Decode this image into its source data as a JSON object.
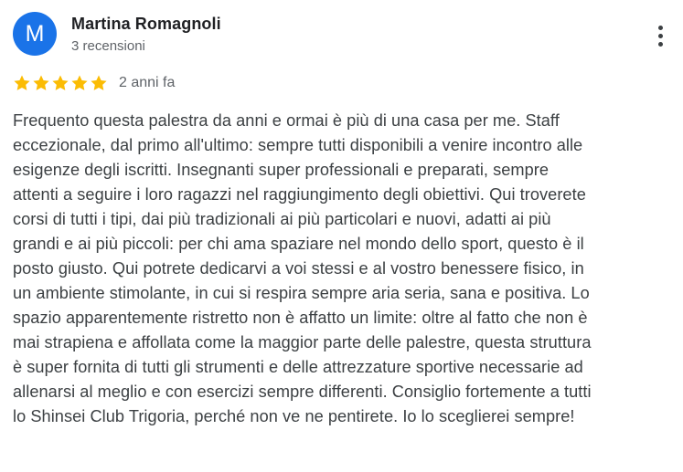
{
  "reviewer": {
    "avatar_initial": "M",
    "name": "Martina Romagnoli",
    "meta": "3 recensioni",
    "avatar_color": "#1a73e8"
  },
  "review": {
    "rating": 5,
    "max_rating": 5,
    "star_color": "#fbbc04",
    "date": "2 anni fa",
    "text_lines": [
      "Frequento questa palestra da anni e ormai è più di una casa per me. Staff",
      "eccezionale, dal primo all'ultimo: sempre tutti disponibili a venire incontro alle",
      "esigenze degli iscritti. Insegnanti super professionali e preparati, sempre",
      "attenti a seguire i loro ragazzi nel raggiungimento degli obiettivi. Qui troverete",
      "corsi di tutti i tipi, dai più tradizionali ai più particolari e nuovi, adatti ai più",
      "grandi e ai più piccoli: per chi ama spaziare nel mondo dello sport, questo è il",
      "posto giusto. Qui potrete dedicarvi a voi stessi e al vostro benessere fisico, in",
      "un ambiente stimolante, in cui si respira sempre aria seria, sana e positiva. Lo",
      "spazio apparentemente ristretto non è affatto un limite: oltre al fatto che non è",
      "mai strapiena e affollata come la maggior parte delle palestre, questa struttura",
      "è super fornita di tutti gli strumenti e delle attrezzature sportive necessarie ad",
      "allenarsi al meglio e con esercizi sempre differenti. Consiglio fortemente a tutti",
      "lo Shinsei Club Trigoria, perché non ve ne pentirete. Io lo sceglierei sempre!"
    ]
  },
  "icons": {
    "more": "more-vert-icon",
    "star": "star-icon"
  }
}
